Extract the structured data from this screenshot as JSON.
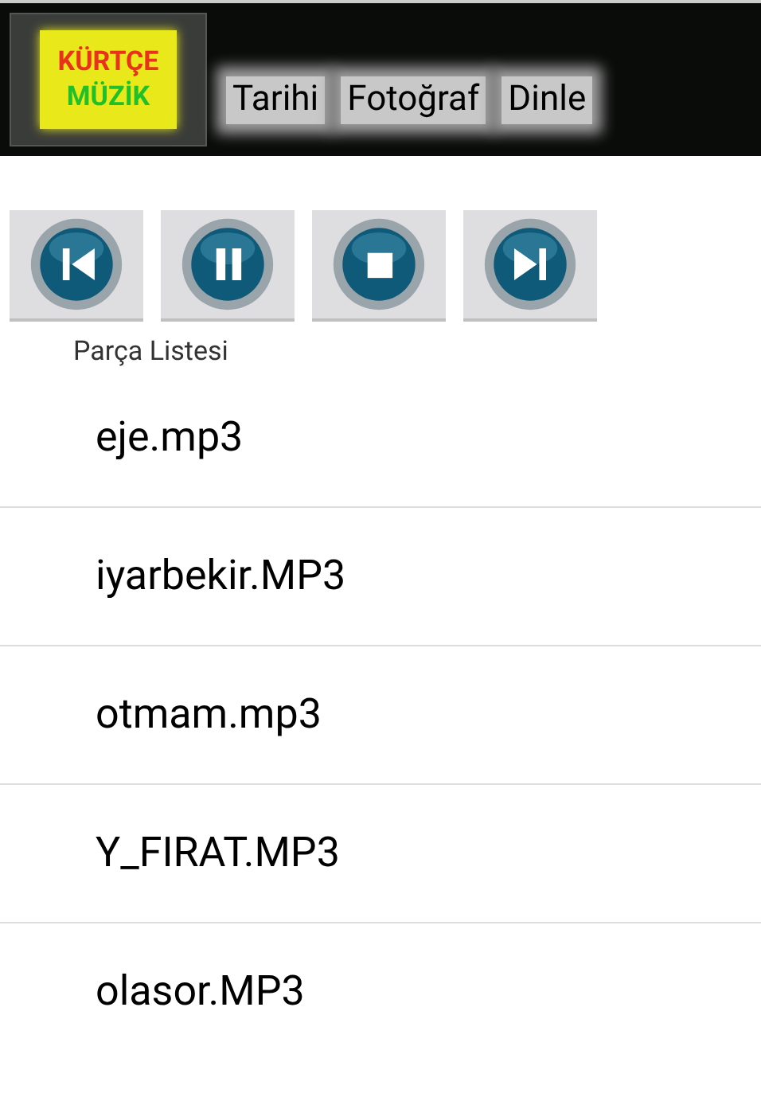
{
  "logo": {
    "line_1": "KÜRTÇE",
    "line_2": "MÜZİK"
  },
  "tabs": [
    {
      "label": "Tarihi"
    },
    {
      "label": "Fotoğraf"
    },
    {
      "label": "Dinle"
    }
  ],
  "controls": [
    {
      "kind": "previous"
    },
    {
      "kind": "pause"
    },
    {
      "kind": "stop"
    },
    {
      "kind": "next"
    }
  ],
  "playlist_label": "Parça Listesi",
  "tracks": [
    "eje.mp3",
    "iyarbekir.MP3",
    "otmam.mp3",
    "Y_FIRAT.MP3",
    "olasor.MP3"
  ]
}
